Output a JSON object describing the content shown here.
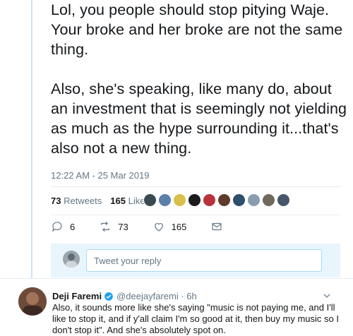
{
  "tweet": {
    "paragraph1": "Lol, you people should stop pitying Waje. Your broke and her broke are not the same thing.",
    "paragraph2": "Also, she's speaking, like many do, about an investment that is seemingly not yielding as much as the hype surrounding it...that's also not a new thing.",
    "timestamp": "12:22 AM - 25 Mar 2019",
    "retweets_count": "73",
    "retweets_label": "Retweets",
    "likes_count": "165",
    "likes_label": "Likes"
  },
  "actions": {
    "reply_count": "6",
    "retweet_count": "73",
    "like_count": "165"
  },
  "reply": {
    "placeholder": "Tweet your reply"
  },
  "next_tweet": {
    "name": "Deji Faremi",
    "handle": "@deejayfaremi · 6h",
    "text": "Also, it sounds more like she's saying \"music is not paying me, and I'll like to stop it, and if y'all claim I'm so good at it, then buy my music so I don't stop it\". And she's absolutely spot on."
  },
  "colors": {
    "accent": "#1da1f2",
    "muted": "#657786",
    "reply_bg": "#e8f5fd"
  },
  "liker_avatar_colors": [
    "#3b4a52",
    "#5b7fa8",
    "#d8c04a",
    "#1b1b1b",
    "#b8323b",
    "#5e3b2a",
    "#2e4e6e",
    "#8a9db0",
    "#6f6a5c",
    "#47566b"
  ]
}
